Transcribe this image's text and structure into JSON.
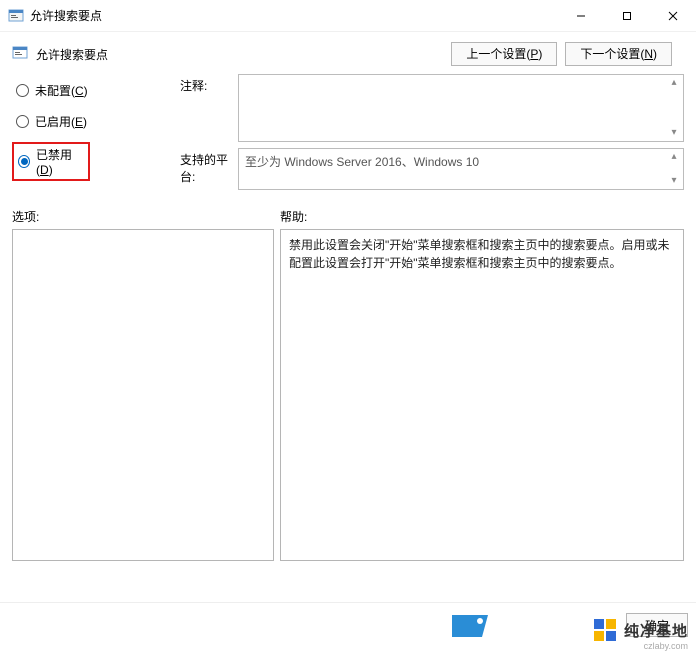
{
  "window": {
    "title": "允许搜索要点"
  },
  "subtitle": "允许搜索要点",
  "topButtons": {
    "prev": {
      "prefix": "上一个设置(",
      "accel": "P",
      "suffix": ")"
    },
    "next": {
      "prefix": "下一个设置(",
      "accel": "N",
      "suffix": ")"
    }
  },
  "radios": {
    "notConfigured": {
      "label_prefix": "未配置(",
      "accel": "C",
      "suffix": ")",
      "checked": false
    },
    "enabled": {
      "label_prefix": "已启用(",
      "accel": "E",
      "suffix": ")",
      "checked": false
    },
    "disabled": {
      "label_prefix": "已禁用(",
      "accel": "D",
      "suffix": ")",
      "checked": true
    }
  },
  "fields": {
    "commentLabel": "注释:",
    "commentValue": "",
    "platformLabel": "支持的平台:",
    "platformValue": "至少为 Windows Server 2016、Windows 10"
  },
  "sections": {
    "optionsLabel": "选项:",
    "helpLabel": "帮助:"
  },
  "helpText": "禁用此设置会关闭\"开始\"菜单搜索框和搜索主页中的搜索要点。启用或未配置此设置会打开\"开始\"菜单搜索框和搜索主页中的搜索要点。",
  "bottom": {
    "okLabel": "确定"
  },
  "watermark": {
    "brand": "纯净基地",
    "domain": "czlaby.com"
  }
}
